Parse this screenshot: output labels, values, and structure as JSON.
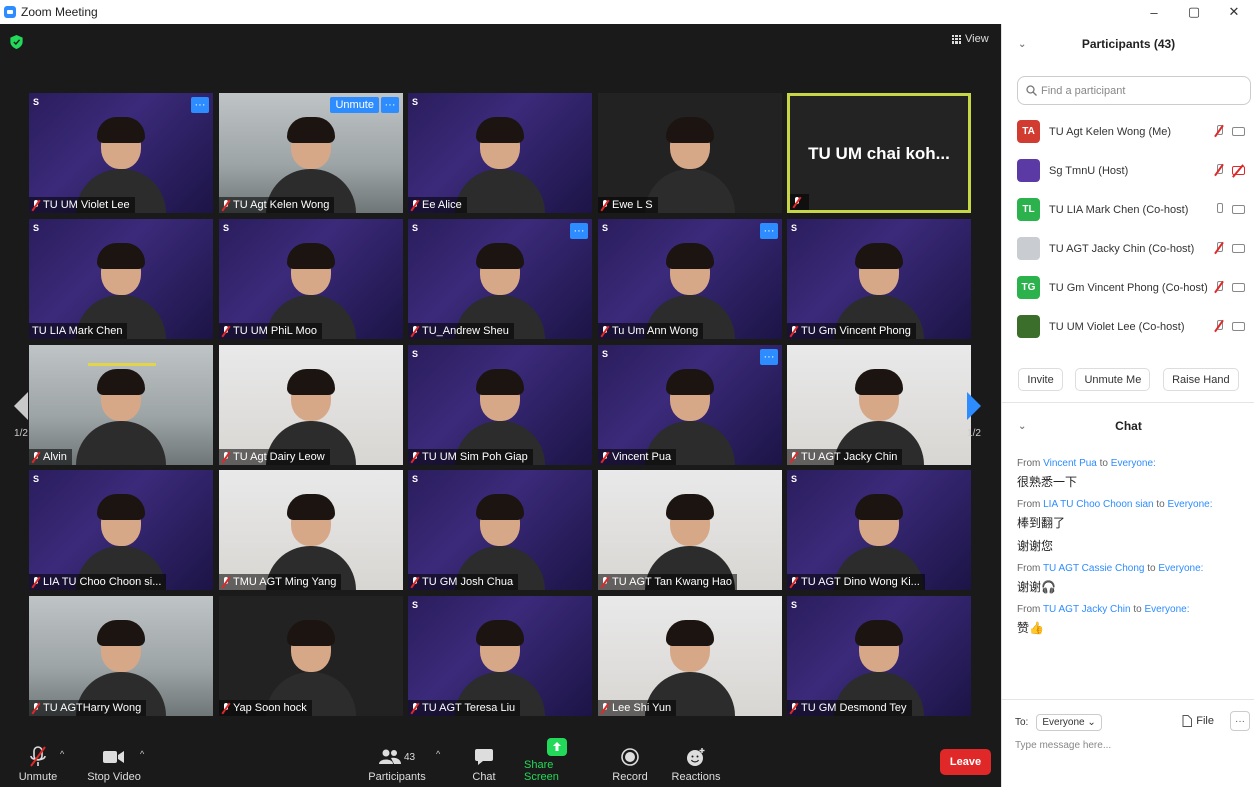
{
  "window": {
    "title": "Zoom Meeting",
    "minimize": "–",
    "maximize": "▢",
    "close": "✕"
  },
  "stage": {
    "view_label": "View",
    "page_indicator": "1/2",
    "tiles": [
      {
        "name": "TU UM Violet Lee",
        "style": "promo",
        "more": true
      },
      {
        "name": "TU Agt Kelen Wong",
        "style": "room",
        "more": true,
        "unmute": "Unmute"
      },
      {
        "name": "Ee Alice",
        "style": "promo"
      },
      {
        "name": "Ewe L S",
        "style": "dark"
      },
      {
        "name": "",
        "style": "active",
        "big": "TU UM chai koh..."
      },
      {
        "name": "TU LIA Mark Chen",
        "style": "promo",
        "nomic": true
      },
      {
        "name": "TU UM PhiL Moo",
        "style": "promo"
      },
      {
        "name": "TU_Andrew Sheu",
        "style": "promo",
        "more": true
      },
      {
        "name": "Tu Um Ann Wong",
        "style": "promo",
        "more": true
      },
      {
        "name": "TU Gm Vincent Phong",
        "style": "promo"
      },
      {
        "name": "Alvin",
        "style": "room"
      },
      {
        "name": "TU Agt Dairy Leow",
        "style": "light"
      },
      {
        "name": "TU UM Sim Poh Giap",
        "style": "promo"
      },
      {
        "name": "Vincent Pua",
        "style": "promo",
        "more": true
      },
      {
        "name": "TU AGT Jacky Chin",
        "style": "light"
      },
      {
        "name": "LIA TU Choo Choon si...",
        "style": "promo"
      },
      {
        "name": "TMU AGT Ming Yang",
        "style": "light"
      },
      {
        "name": "TU GM Josh Chua",
        "style": "promo"
      },
      {
        "name": "TU AGT Tan Kwang Hao",
        "style": "light"
      },
      {
        "name": "TU AGT Dino Wong Ki...",
        "style": "promo"
      },
      {
        "name": "TU AGTHarry Wong",
        "style": "room"
      },
      {
        "name": "Yap Soon hock",
        "style": "dark"
      },
      {
        "name": "TU AGT Teresa Liu",
        "style": "promo"
      },
      {
        "name": "Lee Shi Yun",
        "style": "light"
      },
      {
        "name": "TU GM Desmond Tey",
        "style": "promo"
      }
    ]
  },
  "toolbar": {
    "unmute": "Unmute",
    "stop_video": "Stop Video",
    "participants": "Participants",
    "participants_count": "43",
    "chat": "Chat",
    "share_screen": "Share Screen",
    "record": "Record",
    "reactions": "Reactions",
    "leave": "Leave"
  },
  "participants_panel": {
    "title": "Participants (43)",
    "search_placeholder": "Find a participant",
    "list": [
      {
        "initials": "TA",
        "name": "TU Agt Kelen Wong (Me)",
        "color": "#d23b2f",
        "mic_off": true,
        "cam_off": false
      },
      {
        "initials": "",
        "name": "Sg TmnU (Host)",
        "color": "#5b3aa6",
        "mic_off": true,
        "cam_off": true
      },
      {
        "initials": "TL",
        "name": "TU LIA Mark Chen (Co-host)",
        "color": "#2bb24c",
        "mic_off": false,
        "cam_off": false
      },
      {
        "initials": "",
        "name": "TU AGT Jacky Chin (Co-host)",
        "color": "#c9cdd2",
        "mic_off": true,
        "cam_off": false
      },
      {
        "initials": "TG",
        "name": "TU Gm Vincent Phong (Co-host)",
        "color": "#2bb24c",
        "mic_off": true,
        "cam_off": false
      },
      {
        "initials": "",
        "name": "TU UM Violet Lee (Co-host)",
        "color": "#3a6e2a",
        "mic_off": true,
        "cam_off": false
      }
    ],
    "invite": "Invite",
    "unmute_me": "Unmute Me",
    "raise_hand": "Raise Hand"
  },
  "chat_panel": {
    "title": "Chat",
    "from_word": "From",
    "to_word": "to",
    "messages": [
      {
        "from": "Vincent Pua",
        "to": "Everyone:",
        "lines": [
          "很熟悉一下"
        ]
      },
      {
        "from": "LIA TU Choo Choon sian",
        "to": "Everyone:",
        "lines": [
          "棒到翻了",
          "谢谢您"
        ]
      },
      {
        "from": "TU AGT Cassie Chong",
        "to": "Everyone:",
        "lines": [
          "谢谢🎧"
        ]
      },
      {
        "from": "TU AGT Jacky Chin",
        "to": "Everyone:",
        "lines": [
          "赞👍"
        ]
      }
    ],
    "to_label": "To:",
    "recipient": "Everyone ⌄",
    "file": "File",
    "more": "···",
    "input_placeholder": "Type message here..."
  },
  "colors": {
    "accent": "#2d8cff",
    "leave": "#e02828",
    "active_border": "#c7d645",
    "share": "#23d959"
  }
}
